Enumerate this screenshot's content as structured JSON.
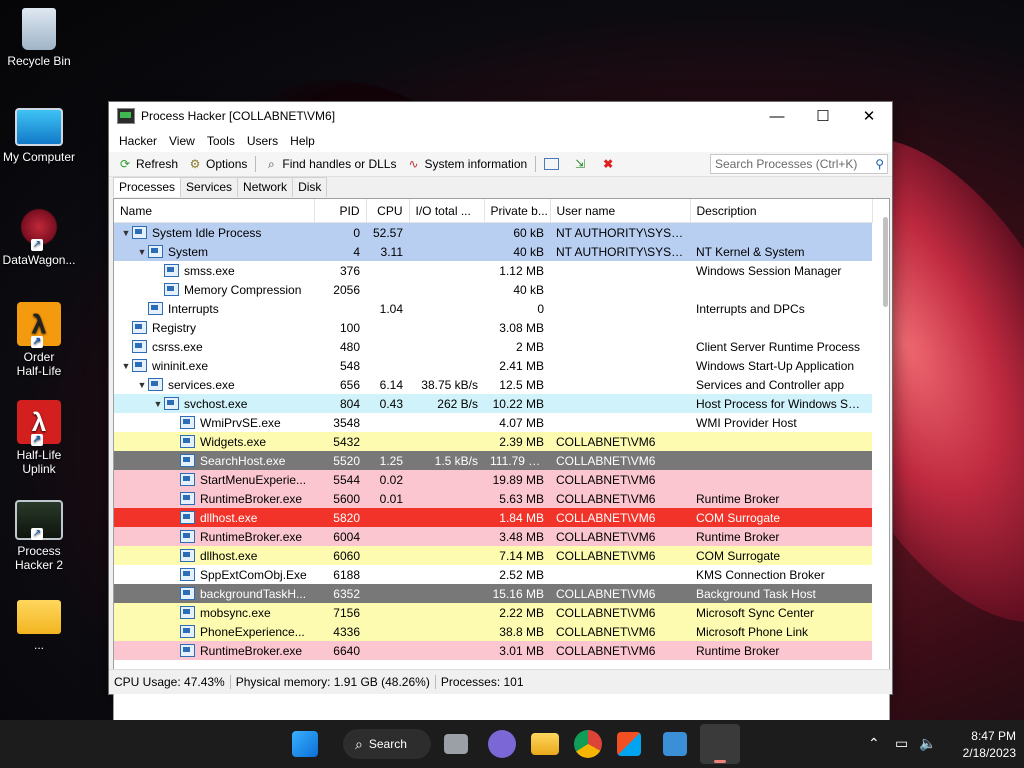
{
  "desktop": {
    "icons": [
      {
        "label": "Recycle Bin"
      },
      {
        "label": "My Computer"
      },
      {
        "label": "DataWagon..."
      },
      {
        "label": "Order\nHalf-Life"
      },
      {
        "label": "Half-Life\nUplink"
      },
      {
        "label": "Process\nHacker 2"
      },
      {
        "label": "..."
      }
    ]
  },
  "window": {
    "title": "Process Hacker [COLLABNET\\VM6]",
    "controls": {
      "minimize": "—",
      "maximize": "☐",
      "close": "✕"
    },
    "menu": [
      "Hacker",
      "View",
      "Tools",
      "Users",
      "Help"
    ],
    "toolbar": {
      "refresh": "Refresh",
      "options": "Options",
      "find_handles": "Find handles or DLLs",
      "system_info": "System information",
      "search_placeholder": "Search Processes (Ctrl+K)"
    },
    "tabs": [
      "Processes",
      "Services",
      "Network",
      "Disk"
    ],
    "columns": [
      "Name",
      "PID",
      "CPU",
      "I/O total ...",
      "Private b...",
      "User name",
      "Description"
    ],
    "rows": [
      {
        "indent": 0,
        "exp": "▼",
        "name": "System Idle Process",
        "pid": "0",
        "cpu": "52.57",
        "io": "",
        "priv": "60 kB",
        "user": "NT AUTHORITY\\SYSTEM",
        "desc": "",
        "bg": "#b9cff2"
      },
      {
        "indent": 1,
        "exp": "▼",
        "name": "System",
        "pid": "4",
        "cpu": "3.11",
        "io": "",
        "priv": "40 kB",
        "user": "NT AUTHORITY\\SYSTEM",
        "desc": "NT Kernel & System",
        "bg": "#b9cff2"
      },
      {
        "indent": 2,
        "exp": "",
        "name": "smss.exe",
        "pid": "376",
        "cpu": "",
        "io": "",
        "priv": "1.12 MB",
        "user": "",
        "desc": "Windows Session Manager",
        "bg": "#ffffff"
      },
      {
        "indent": 2,
        "exp": "",
        "name": "Memory Compression",
        "pid": "2056",
        "cpu": "",
        "io": "",
        "priv": "40 kB",
        "user": "",
        "desc": "",
        "bg": "#ffffff"
      },
      {
        "indent": 1,
        "exp": "",
        "name": "Interrupts",
        "pid": "",
        "cpu": "1.04",
        "io": "",
        "priv": "0",
        "user": "",
        "desc": "Interrupts and DPCs",
        "bg": "#ffffff"
      },
      {
        "indent": 0,
        "exp": "",
        "name": "Registry",
        "pid": "100",
        "cpu": "",
        "io": "",
        "priv": "3.08 MB",
        "user": "",
        "desc": "",
        "bg": "#ffffff"
      },
      {
        "indent": 0,
        "exp": "",
        "name": "csrss.exe",
        "pid": "480",
        "cpu": "",
        "io": "",
        "priv": "2 MB",
        "user": "",
        "desc": "Client Server Runtime Process",
        "bg": "#ffffff"
      },
      {
        "indent": 0,
        "exp": "▼",
        "name": "wininit.exe",
        "pid": "548",
        "cpu": "",
        "io": "",
        "priv": "2.41 MB",
        "user": "",
        "desc": "Windows Start-Up Application",
        "bg": "#ffffff"
      },
      {
        "indent": 1,
        "exp": "▼",
        "name": "services.exe",
        "pid": "656",
        "cpu": "6.14",
        "io": "38.75 kB/s",
        "priv": "12.5 MB",
        "user": "",
        "desc": "Services and Controller app",
        "bg": "#ffffff"
      },
      {
        "indent": 2,
        "exp": "▼",
        "name": "svchost.exe",
        "pid": "804",
        "cpu": "0.43",
        "io": "262 B/s",
        "priv": "10.22 MB",
        "user": "",
        "desc": "Host Process for Windows Ser...",
        "bg": "#d0f2fb"
      },
      {
        "indent": 3,
        "exp": "",
        "name": "WmiPrvSE.exe",
        "pid": "3548",
        "cpu": "",
        "io": "",
        "priv": "4.07 MB",
        "user": "",
        "desc": "WMI Provider Host",
        "bg": "#ffffff"
      },
      {
        "indent": 3,
        "exp": "",
        "name": "Widgets.exe",
        "pid": "5432",
        "cpu": "",
        "io": "",
        "priv": "2.39 MB",
        "user": "COLLABNET\\VM6",
        "desc": "",
        "bg": "#fdfbb0"
      },
      {
        "indent": 3,
        "exp": "",
        "name": "SearchHost.exe",
        "pid": "5520",
        "cpu": "1.25",
        "io": "1.5 kB/s",
        "priv": "111.79 MB",
        "user": "COLLABNET\\VM6",
        "desc": "",
        "bg": "#787878",
        "fg": "#ffffff"
      },
      {
        "indent": 3,
        "exp": "",
        "name": "StartMenuExperie...",
        "pid": "5544",
        "cpu": "0.02",
        "io": "",
        "priv": "19.89 MB",
        "user": "COLLABNET\\VM6",
        "desc": "",
        "bg": "#fbc6cf"
      },
      {
        "indent": 3,
        "exp": "",
        "name": "RuntimeBroker.exe",
        "pid": "5600",
        "cpu": "0.01",
        "io": "",
        "priv": "5.63 MB",
        "user": "COLLABNET\\VM6",
        "desc": "Runtime Broker",
        "bg": "#fbc6cf"
      },
      {
        "indent": 3,
        "exp": "",
        "name": "dllhost.exe",
        "pid": "5820",
        "cpu": "",
        "io": "",
        "priv": "1.84 MB",
        "user": "COLLABNET\\VM6",
        "desc": "COM Surrogate",
        "bg": "#f2332a",
        "fg": "#ffffff"
      },
      {
        "indent": 3,
        "exp": "",
        "name": "RuntimeBroker.exe",
        "pid": "6004",
        "cpu": "",
        "io": "",
        "priv": "3.48 MB",
        "user": "COLLABNET\\VM6",
        "desc": "Runtime Broker",
        "bg": "#fbc6cf"
      },
      {
        "indent": 3,
        "exp": "",
        "name": "dllhost.exe",
        "pid": "6060",
        "cpu": "",
        "io": "",
        "priv": "7.14 MB",
        "user": "COLLABNET\\VM6",
        "desc": "COM Surrogate",
        "bg": "#fdfbb0"
      },
      {
        "indent": 3,
        "exp": "",
        "name": "SppExtComObj.Exe",
        "pid": "6188",
        "cpu": "",
        "io": "",
        "priv": "2.52 MB",
        "user": "",
        "desc": "KMS Connection Broker",
        "bg": "#ffffff"
      },
      {
        "indent": 3,
        "exp": "",
        "name": "backgroundTaskH...",
        "pid": "6352",
        "cpu": "",
        "io": "",
        "priv": "15.16 MB",
        "user": "COLLABNET\\VM6",
        "desc": "Background Task Host",
        "bg": "#787878",
        "fg": "#ffffff"
      },
      {
        "indent": 3,
        "exp": "",
        "name": "mobsync.exe",
        "pid": "7156",
        "cpu": "",
        "io": "",
        "priv": "2.22 MB",
        "user": "COLLABNET\\VM6",
        "desc": "Microsoft Sync Center",
        "bg": "#fdfbb0"
      },
      {
        "indent": 3,
        "exp": "",
        "name": "PhoneExperience...",
        "pid": "4336",
        "cpu": "",
        "io": "",
        "priv": "38.8 MB",
        "user": "COLLABNET\\VM6",
        "desc": "Microsoft Phone Link",
        "bg": "#fdfbb0"
      },
      {
        "indent": 3,
        "exp": "",
        "name": "RuntimeBroker.exe",
        "pid": "6640",
        "cpu": "",
        "io": "",
        "priv": "3.01 MB",
        "user": "COLLABNET\\VM6",
        "desc": "Runtime Broker",
        "bg": "#fbc6cf"
      }
    ],
    "status": {
      "cpu": "CPU Usage: 47.43%",
      "memory": "Physical memory: 1.91 GB (48.26%)",
      "processes": "Processes: 101"
    }
  },
  "taskbar": {
    "search_label": "Search",
    "time": "8:47 PM",
    "date": "2/18/2023"
  }
}
